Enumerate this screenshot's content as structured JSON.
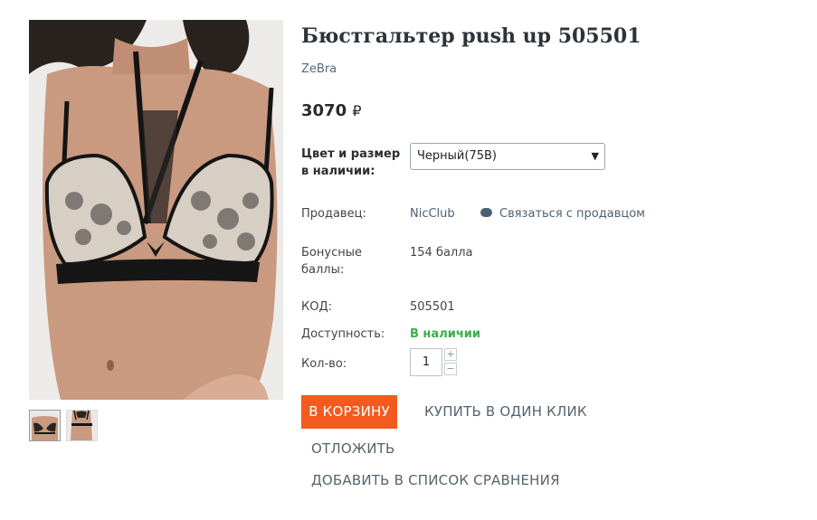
{
  "product": {
    "title": "Бюстгальтер push up 505501",
    "brand": "ZeBra",
    "price_value": "3070",
    "currency_symbol": "₽"
  },
  "variant": {
    "label": "Цвет и размер в наличии:",
    "selected": "Черный(75B)"
  },
  "seller": {
    "label": "Продавец:",
    "name": "NicClub",
    "contact_label": "Связаться с продавцом",
    "contact_icon": "chat-bubble-icon"
  },
  "bonus": {
    "label": "Бонусные баллы:",
    "value": "154 балла"
  },
  "code": {
    "label": "КОД:",
    "value": "505501"
  },
  "availability": {
    "label": "Доступность:",
    "value": "В наличии",
    "color": "#39b04a"
  },
  "quantity": {
    "label": "Кол-во:",
    "value": "1",
    "plus": "+",
    "minus": "−"
  },
  "actions": {
    "cart": "В КОРЗИНУ",
    "cart_color": "#f25a1f",
    "one_click": "КУПИТЬ В ОДИН КЛИК",
    "postpone": "ОТЛОЖИТЬ",
    "compare": "ДОБАВИТЬ В СПИСОК СРАВНЕНИЯ"
  },
  "gallery": {
    "thumbnails": [
      "front-view-thumbnail",
      "back-view-thumbnail"
    ]
  }
}
